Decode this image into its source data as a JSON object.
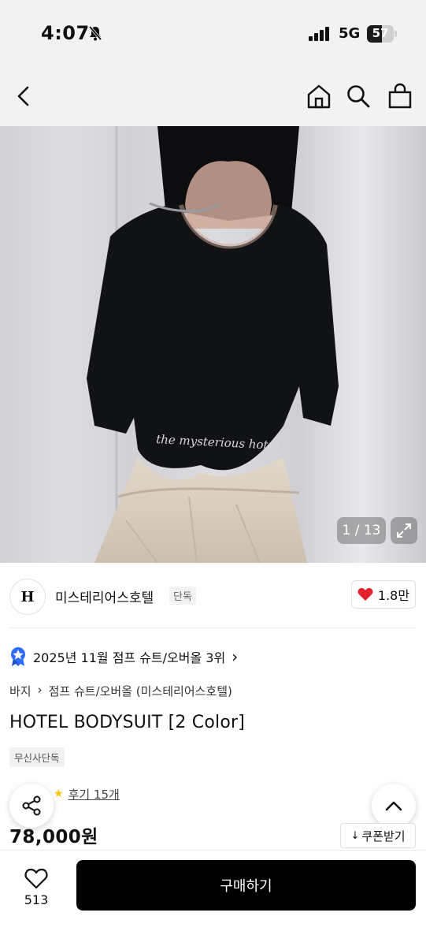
{
  "status_bar": {
    "time": "4:07",
    "network": "5G",
    "battery": "57",
    "battery_level": 0.57
  },
  "nav": {
    "back_icon": "chevron-left-icon",
    "home_icon": "home-icon",
    "search_icon": "search-icon",
    "cart_icon": "shopping-bag-icon"
  },
  "product_image": {
    "print_text": "the mysterious hotel",
    "counter": "1 / 13"
  },
  "brand": {
    "logo_text": "H",
    "name": "미스테리어스호텔",
    "tag": "단독",
    "likes": "1.8만"
  },
  "ranking": {
    "text": "2025년 11월 점프 슈트/오버올 3위",
    "chevron": "›"
  },
  "breadcrumb": {
    "category": "바지",
    "separator": "›",
    "subcategory": "점프 슈트/오버올 (미스테리어스호텔)"
  },
  "product": {
    "title": "HOTEL BODYSUIT [2 Color]",
    "badge": "무신사단독",
    "reviews_label": "후기 15개",
    "price": "78,000원"
  },
  "coupon": {
    "label": "쿠폰받기",
    "icon": "↓"
  },
  "bottom": {
    "wish_count": "513",
    "buy_label": "구매하기"
  },
  "colors": {
    "accent": "#000000",
    "heart": "#e5202e",
    "rank_badge": "#2d6bff",
    "star": "#ffc107"
  }
}
